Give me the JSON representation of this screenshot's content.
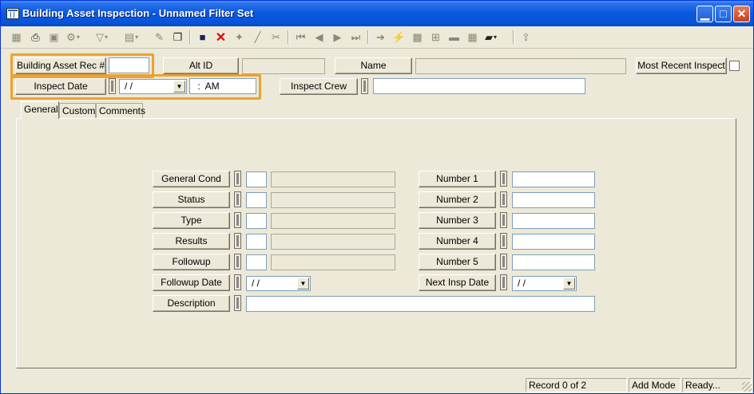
{
  "window": {
    "title": "Building Asset Inspection - Unnamed Filter Set"
  },
  "header": {
    "building_asset_rec_label": "Building Asset Rec #",
    "alt_id_label": "Alt ID",
    "name_label": "Name",
    "most_recent_inspect_label": "Most Recent Inspect",
    "inspect_date_label": "Inspect Date",
    "inspect_date_value": " / /",
    "inspect_time_value": " :  AM",
    "inspect_crew_label": "Inspect Crew"
  },
  "tabs": [
    {
      "label": "General"
    },
    {
      "label": "Custom"
    },
    {
      "label": "Comments"
    }
  ],
  "general": {
    "left_fields": [
      {
        "label": "General Cond"
      },
      {
        "label": "Status"
      },
      {
        "label": "Type"
      },
      {
        "label": "Results"
      },
      {
        "label": "Followup"
      }
    ],
    "followup_date_label": "Followup Date",
    "followup_date_value": " / /",
    "description_label": "Description",
    "right_fields": [
      {
        "label": "Number 1"
      },
      {
        "label": "Number 2"
      },
      {
        "label": "Number 3"
      },
      {
        "label": "Number 4"
      },
      {
        "label": "Number 5"
      }
    ],
    "next_insp_date_label": "Next Insp Date",
    "next_insp_date_value": " / /"
  },
  "statusbar": {
    "record": "Record 0 of 2",
    "mode": "Add Mode",
    "state": "Ready..."
  },
  "colors": {
    "highlight": "#f0a030",
    "titlebar": "#0a58e0",
    "delete": "#e00000"
  }
}
